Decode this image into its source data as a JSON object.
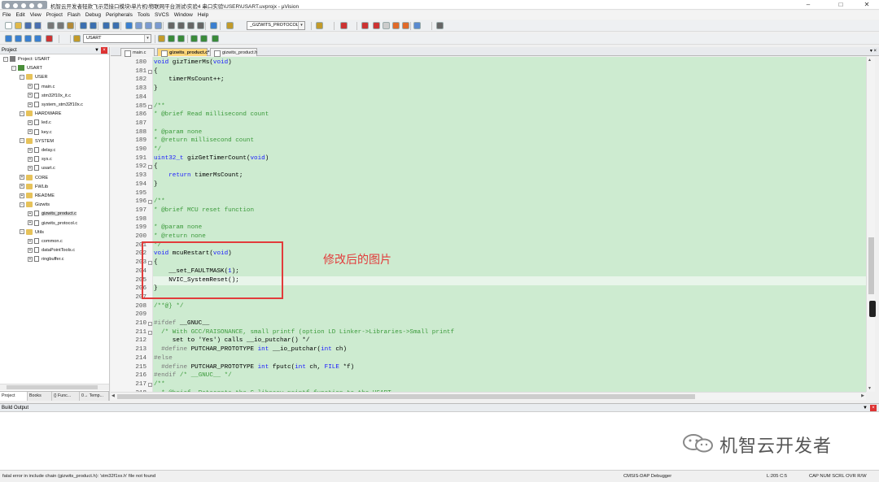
{
  "window": {
    "title": "机智云开发者轻款飞示范接口模块\\单片机\\物联网平台测试\\实验4 串口实验\\USER\\USART.uvprojx - µVision",
    "minimize_icon": "minimize-icon",
    "maximize_icon": "maximize-icon",
    "close_icon": "close-icon"
  },
  "menu": [
    "File",
    "Edit",
    "View",
    "Project",
    "Flash",
    "Debug",
    "Peripherals",
    "Tools",
    "SVCS",
    "Window",
    "Help"
  ],
  "toolbar": {
    "find_combo": "_GIZWITS_PROTOCOL_H",
    "target_combo": "USART"
  },
  "project_panel": {
    "title": "Project",
    "tree": [
      {
        "label": "Project: USART",
        "level": 0,
        "kind": "proj",
        "exp": "-"
      },
      {
        "label": "USART",
        "level": 1,
        "kind": "tgt",
        "exp": "-"
      },
      {
        "label": "USER",
        "level": 2,
        "kind": "folder",
        "exp": "-"
      },
      {
        "label": "main.c",
        "level": 3,
        "kind": "file",
        "exp": "+"
      },
      {
        "label": "stm32f10x_it.c",
        "level": 3,
        "kind": "file",
        "exp": "+"
      },
      {
        "label": "system_stm32f10x.c",
        "level": 3,
        "kind": "file",
        "exp": "+"
      },
      {
        "label": "HARDWARE",
        "level": 2,
        "kind": "folder",
        "exp": "-"
      },
      {
        "label": "led.c",
        "level": 3,
        "kind": "file",
        "exp": "+"
      },
      {
        "label": "key.c",
        "level": 3,
        "kind": "file",
        "exp": "+"
      },
      {
        "label": "SYSTEM",
        "level": 2,
        "kind": "folder",
        "exp": "-"
      },
      {
        "label": "delay.c",
        "level": 3,
        "kind": "file",
        "exp": "+"
      },
      {
        "label": "sys.c",
        "level": 3,
        "kind": "file",
        "exp": "+"
      },
      {
        "label": "usart.c",
        "level": 3,
        "kind": "file",
        "exp": "+"
      },
      {
        "label": "CORE",
        "level": 2,
        "kind": "folder",
        "exp": "+"
      },
      {
        "label": "FWLib",
        "level": 2,
        "kind": "folder",
        "exp": "+"
      },
      {
        "label": "README",
        "level": 2,
        "kind": "folder",
        "exp": "+"
      },
      {
        "label": "Gizwits",
        "level": 2,
        "kind": "folder",
        "exp": "-"
      },
      {
        "label": "gizwits_product.c",
        "level": 3,
        "kind": "file",
        "exp": "+",
        "selected": true
      },
      {
        "label": "gizwits_protocol.c",
        "level": 3,
        "kind": "file",
        "exp": "+"
      },
      {
        "label": "Utils",
        "level": 2,
        "kind": "folder",
        "exp": "-"
      },
      {
        "label": "common.c",
        "level": 3,
        "kind": "file",
        "exp": "+"
      },
      {
        "label": "dataPointTools.c",
        "level": 3,
        "kind": "file",
        "exp": "+"
      },
      {
        "label": "ringbuffer.c",
        "level": 3,
        "kind": "file",
        "exp": "+"
      }
    ],
    "tabs": [
      "Project",
      "Books",
      "{} Func...",
      "0→ Temp..."
    ]
  },
  "editor_tabs": [
    {
      "label": "main.c",
      "active": false
    },
    {
      "label": "gizwits_product.c*",
      "active": true
    },
    {
      "label": "gizwits_product.h",
      "active": false
    }
  ],
  "code": {
    "lines": [
      {
        "n": "180",
        "t": "void gizTimerMs(void)"
      },
      {
        "n": "181",
        "t": "{"
      },
      {
        "n": "182",
        "t": "    timerMsCount++;"
      },
      {
        "n": "183",
        "t": "}"
      },
      {
        "n": "184",
        "t": ""
      },
      {
        "n": "185",
        "t": "/**"
      },
      {
        "n": "186",
        "t": "* @brief Read millisecond count"
      },
      {
        "n": "187",
        "t": ""
      },
      {
        "n": "188",
        "t": "* @param none"
      },
      {
        "n": "189",
        "t": "* @return millisecond count"
      },
      {
        "n": "190",
        "t": "*/"
      },
      {
        "n": "191",
        "t": "uint32_t gizGetTimerCount(void)"
      },
      {
        "n": "192",
        "t": "{"
      },
      {
        "n": "193",
        "t": "    return timerMsCount;"
      },
      {
        "n": "194",
        "t": "}"
      },
      {
        "n": "195",
        "t": ""
      },
      {
        "n": "196",
        "t": "/**"
      },
      {
        "n": "197",
        "t": "* @brief MCU reset function"
      },
      {
        "n": "198",
        "t": ""
      },
      {
        "n": "199",
        "t": "* @param none"
      },
      {
        "n": "200",
        "t": "* @return none"
      },
      {
        "n": "201",
        "t": "*/"
      },
      {
        "n": "202",
        "t": "void mcuRestart(void)"
      },
      {
        "n": "203",
        "t": "{"
      },
      {
        "n": "204",
        "t": "    __set_FAULTMASK(1);"
      },
      {
        "n": "205",
        "t": "    NVIC_SystemReset();"
      },
      {
        "n": "206",
        "t": "}"
      },
      {
        "n": "207",
        "t": ""
      },
      {
        "n": "208",
        "t": "/**@} */"
      },
      {
        "n": "209",
        "t": ""
      },
      {
        "n": "210",
        "t": "#ifdef __GNUC__"
      },
      {
        "n": "211",
        "t": "  /* With GCC/RAISONANCE, small printf (option LD Linker->Libraries->Small printf"
      },
      {
        "n": "212",
        "t": "     set to 'Yes') calls __io_putchar() */"
      },
      {
        "n": "213",
        "t": "  #define PUTCHAR_PROTOTYPE int __io_putchar(int ch)"
      },
      {
        "n": "214",
        "t": "#else"
      },
      {
        "n": "215",
        "t": "  #define PUTCHAR_PROTOTYPE int fputc(int ch, FILE *f)"
      },
      {
        "n": "216",
        "t": "#endif /* __GNUC__ */"
      },
      {
        "n": "217",
        "t": "/**"
      },
      {
        "n": "218",
        "t": "  * @brief  Retargets the C library printf function to the USART."
      }
    ]
  },
  "annotation": "修改后的图片",
  "build_output": {
    "title": "Build Output"
  },
  "watermark": "机智云开发者",
  "status": {
    "message": "fatal error in include chain (gizwits_product.h): 'stm32f1xx.h' file not found",
    "debugger": "CMSIS-DAP Debugger",
    "position": "L:205 C:5",
    "indicators": "CAP NUM SCRL OVR R/W"
  },
  "colors": {
    "editor_bg": "#cdebd0",
    "highlight": "#e23b3b",
    "active_tab": "#ffd77a"
  }
}
